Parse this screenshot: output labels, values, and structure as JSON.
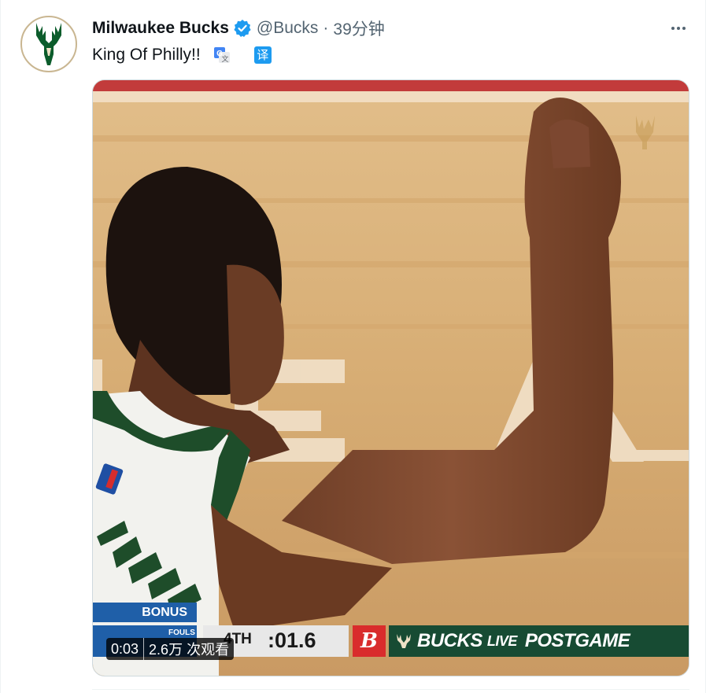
{
  "tweet": {
    "display_name": "Milwaukee Bucks",
    "handle": "@Bucks",
    "separator": "·",
    "time": "39分钟",
    "text": "King Of Philly!!",
    "translate_label": "译"
  },
  "media": {
    "scoreboard": {
      "bonus_label": "BONUS",
      "fouls_label": "FOULS",
      "period": "4TH",
      "clock": ":01.6",
      "sponsor_letter": "B",
      "brand_name": "BUCKS",
      "live_label": "LIVE",
      "postgame_label": "POSTGAME"
    },
    "timecode": "0:03",
    "views": "2.6万 次观看"
  },
  "colors": {
    "verified_blue": "#1d9bf0",
    "bucks_green": "#174b33",
    "bucks_cream": "#eee1c6"
  },
  "icons": {
    "verified": "verified-badge-icon",
    "more": "more-options-icon",
    "google_translate": "google-translate-icon",
    "translate": "translate-icon",
    "avatar": "bucks-logo-avatar"
  }
}
